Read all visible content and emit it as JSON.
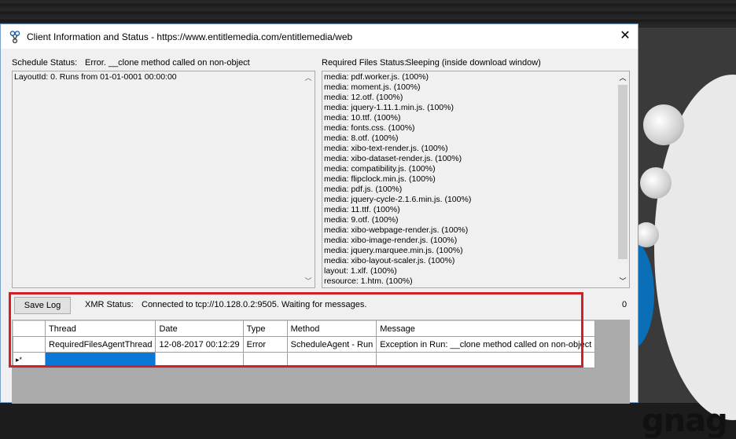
{
  "window": {
    "title": "Client Information and Status - https://www.entitlemedia.com/entitlemedia/web",
    "close_glyph": "✕"
  },
  "schedule": {
    "label": "Schedule Status:",
    "status": "Error. __clone method called on non-object",
    "lines": [
      "LayoutId: 0. Runs from 01-01-0001 00:00:00"
    ]
  },
  "required_files": {
    "label": "Required Files Status:",
    "status": "Sleeping (inside download window)",
    "lines": [
      "media: pdf.worker.js. (100%)",
      "media: moment.js. (100%)",
      "media: 12.otf. (100%)",
      "media: jquery-1.11.1.min.js. (100%)",
      "media: 10.ttf. (100%)",
      "media: fonts.css. (100%)",
      "media: 8.otf. (100%)",
      "media: xibo-text-render.js. (100%)",
      "media: xibo-dataset-render.js. (100%)",
      "media: compatibility.js. (100%)",
      "media: flipclock.min.js. (100%)",
      "media: pdf.js. (100%)",
      "media: jquery-cycle-2.1.6.min.js. (100%)",
      "media: 11.ttf. (100%)",
      "media: 9.otf. (100%)",
      "media: xibo-webpage-render.js. (100%)",
      "media: xibo-image-render.js. (100%)",
      "media: jquery.marquee.min.js. (100%)",
      "media: xibo-layout-scaler.js. (100%)",
      "layout: 1.xlf. (100%)",
      "resource: 1.htm. (100%)"
    ]
  },
  "toolbar": {
    "save_log_label": "Save Log",
    "xmr_label": "XMR Status:",
    "xmr_status": "Connected to tcp://10.128.0.2:9505. Waiting for messages.",
    "count": "0"
  },
  "log_grid": {
    "columns": [
      "Thread",
      "Date",
      "Type",
      "Method",
      "Message"
    ],
    "rows": [
      [
        "RequiredFilesAgentThread",
        "12-08-2017 00:12:29",
        "Error",
        "ScheduleAgent - Run",
        "Exception in Run: __clone method called on non-object"
      ]
    ],
    "new_row_marker": "▸*"
  },
  "background": {
    "partial_text": "gnag"
  },
  "colors": {
    "highlight_border": "#d32027",
    "selection": "#0a78d7",
    "window_border": "#7aa0cc"
  }
}
